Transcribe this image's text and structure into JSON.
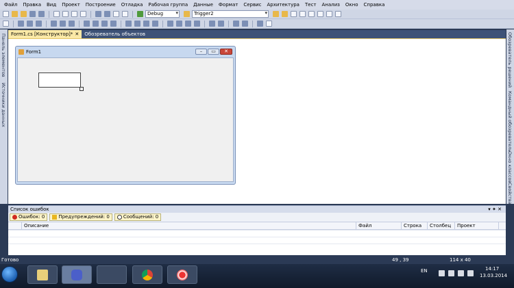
{
  "menu": [
    "Файл",
    "Правка",
    "Вид",
    "Проект",
    "Построение",
    "Отладка",
    "Рабочая группа",
    "Данные",
    "Формат",
    "Сервис",
    "Архитектура",
    "Тест",
    "Анализ",
    "Окно",
    "Справка"
  ],
  "toolbar": {
    "config_value": "Debug",
    "target_value": "Trigger2"
  },
  "left_strip": {
    "toolbox": "Панель элементов",
    "datasources": "Источники данных"
  },
  "right_strip": {
    "solution": "Обозреватель решений",
    "team": "Командный обозреватель",
    "classview": "Окно классов",
    "properties": "Свойства"
  },
  "tabs": [
    {
      "label": "Form1.cs [Конструктор]*",
      "active": true
    },
    {
      "label": "Обозреватель объектов",
      "active": false
    }
  ],
  "form": {
    "title": "Form1"
  },
  "error_list": {
    "title": "Список ошибок",
    "pin": "▾ ✦ ✕",
    "errors": "Ошибок: 0",
    "warnings": "Предупреждений: 0",
    "messages": "Сообщений: 0",
    "columns": [
      "Описание",
      "Файл",
      "Строка",
      "Столбец",
      "Проект"
    ]
  },
  "status": {
    "ready": "Готово",
    "position": "49 , 39",
    "size": "114 x 40"
  },
  "taskbar": {
    "lang": "EN",
    "time": "14:17",
    "date": "13.03.2014"
  }
}
